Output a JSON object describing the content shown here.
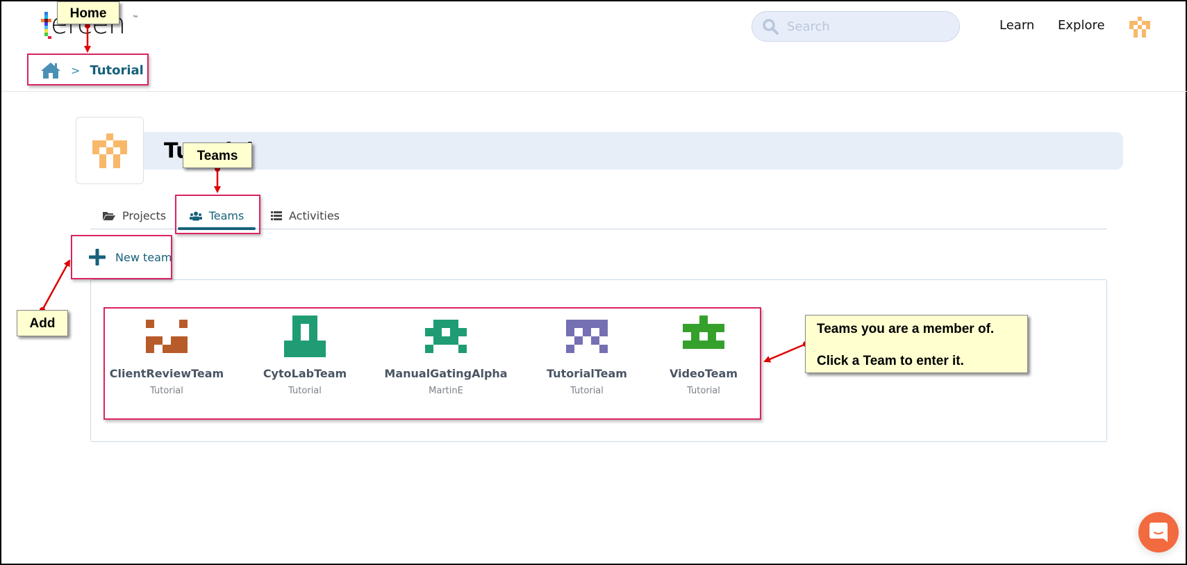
{
  "app": {
    "logo_text": "ercen",
    "logo_tm": "™",
    "brand_colors": {
      "accent": "#17617a",
      "link": "#3a8bb0",
      "chat": "#f26a3f",
      "avatar": "#f8b86a"
    }
  },
  "header": {
    "search": {
      "placeholder": "Search",
      "value": ""
    },
    "nav": {
      "learn": "Learn",
      "explore": "Explore"
    },
    "user_avatar_icon": "identicon-orange"
  },
  "breadcrumb": {
    "home_icon": "home-icon",
    "separator": ">",
    "current": "Tutorial"
  },
  "project": {
    "title": "Tutorial",
    "avatar_icon": "identicon-orange"
  },
  "tabs": [
    {
      "label": "Projects",
      "icon": "folder-open-icon",
      "active": false
    },
    {
      "label": "Teams",
      "icon": "users-icon",
      "active": true
    },
    {
      "label": "Activities",
      "icon": "list-icon",
      "active": false
    }
  ],
  "actions": {
    "new_team": "New team"
  },
  "teams": [
    {
      "name": "ClientReviewTeam",
      "owner": "Tutorial",
      "color": "#b75b2a"
    },
    {
      "name": "CytoLabTeam",
      "owner": "Tutorial",
      "color": "#1f9c74"
    },
    {
      "name": "ManualGatingAlpha",
      "owner": "MartinE",
      "color": "#1f9c74"
    },
    {
      "name": "TutorialTeam",
      "owner": "Tutorial",
      "color": "#7570b3"
    },
    {
      "name": "VideoTeam",
      "owner": "Tutorial",
      "color": "#35a02c"
    }
  ],
  "annotations": {
    "home": "Home",
    "teams": "Teams",
    "add": "Add",
    "teams_info_line1": "Teams you are a member of.",
    "teams_info_line2": "Click a Team to enter it."
  }
}
